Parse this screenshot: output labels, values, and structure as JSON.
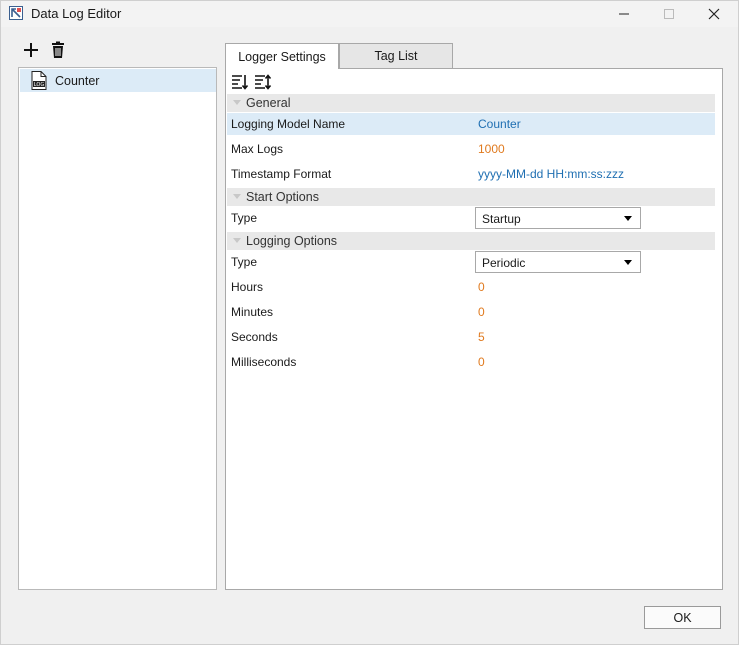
{
  "window": {
    "title": "Data Log Editor"
  },
  "models": [
    {
      "label": "Counter"
    }
  ],
  "tabs": [
    {
      "label": "Logger Settings"
    },
    {
      "label": "Tag List"
    }
  ],
  "categories": {
    "general": "General",
    "start": "Start Options",
    "logging": "Logging Options"
  },
  "general": {
    "name_label": "Logging Model Name",
    "name_value": "Counter",
    "maxlogs_label": "Max Logs",
    "maxlogs_value": "1000",
    "timestamp_label": "Timestamp Format",
    "timestamp_value": "yyyy-MM-dd HH:mm:ss:zzz"
  },
  "start_options": {
    "type_label": "Type",
    "type_value": "Startup"
  },
  "logging_options": {
    "type_label": "Type",
    "type_value": "Periodic",
    "hours_label": "Hours",
    "hours_value": "0",
    "minutes_label": "Minutes",
    "minutes_value": "0",
    "seconds_label": "Seconds",
    "seconds_value": "5",
    "ms_label": "Milliseconds",
    "ms_value": "0"
  },
  "footer": {
    "ok_label": "OK"
  },
  "colors": {
    "selection": "#dcebf7",
    "value_blue": "#1f6fb2",
    "value_orange": "#e07a1f"
  }
}
